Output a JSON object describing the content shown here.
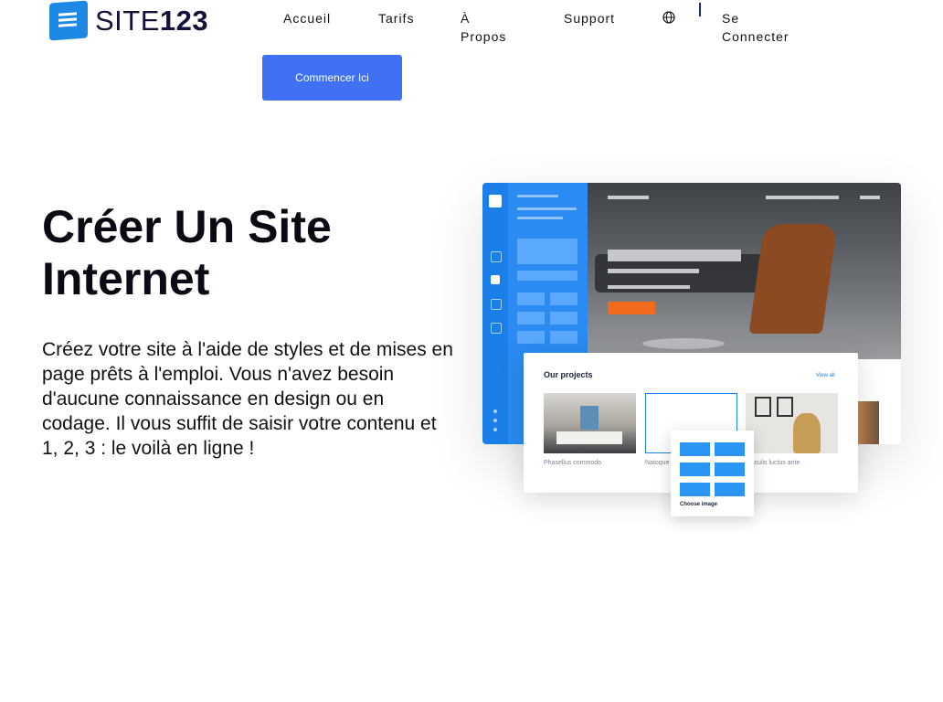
{
  "logo": {
    "prefix": "SITE",
    "suffix": "123"
  },
  "nav": {
    "home": "Accueil",
    "pricing": "Tarifs",
    "about_line1": "À",
    "about_line2": "Propos",
    "support": "Support",
    "login_line1": "Se",
    "login_line2": "Connecter",
    "language_icon": "globe-icon"
  },
  "cta": {
    "label": "Commencer Ici"
  },
  "hero": {
    "title_line1": "Créer Un Site",
    "title_line2": "Internet",
    "description": "Créez votre site à l'aide de styles et de mises en page prêts à l'emploi. Vous n'avez besoin d'aucune connaissance en design ou en codage. Il vous suffit de saisir votre contenu et 1, 2, 3 : le voilà en ligne !"
  },
  "mockup": {
    "card_title": "Our projects",
    "view_all": "View all",
    "project_1": "Phasellus commodo",
    "project_2": "Natoque",
    "project_3": "iculis luctus ante",
    "choose_image": "Choose image"
  },
  "colors": {
    "accent": "#4070f4",
    "brand_blue": "#1e88e5",
    "editor_blue": "#2a8bf2"
  }
}
